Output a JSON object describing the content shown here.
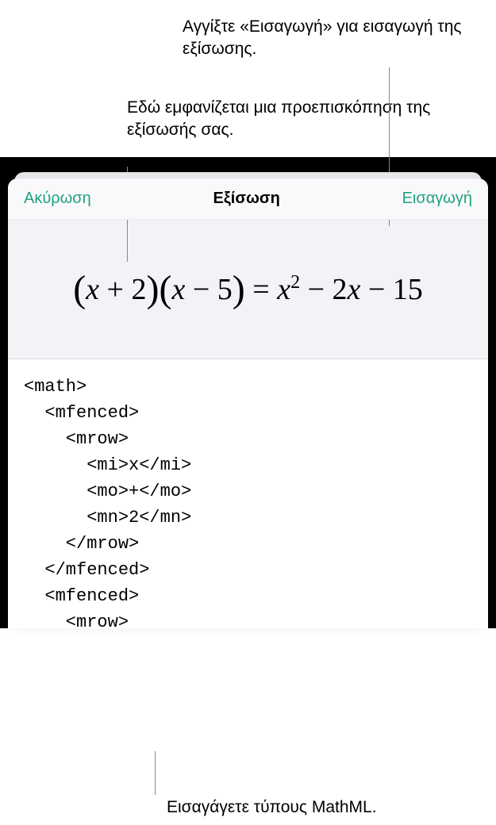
{
  "callouts": {
    "insert_hint": "Αγγίξτε «Εισαγωγή» για εισαγωγή της εξίσωσης.",
    "preview_hint": "Εδώ εμφανίζεται μια προεπισκόπηση της εξίσωσής σας.",
    "mathml_hint": "Εισαγάγετε τύπους MathML."
  },
  "header": {
    "cancel": "Ακύρωση",
    "title": "Εξίσωση",
    "insert": "Εισαγωγή"
  },
  "equation": {
    "display": "(x + 2)(x − 5) = x² − 2x − 15"
  },
  "code": {
    "content": "<math>\n  <mfenced>\n    <mrow>\n      <mi>x</mi>\n      <mo>+</mo>\n      <mn>2</mn>\n    </mrow>\n  </mfenced>\n  <mfenced>\n    <mrow>"
  }
}
